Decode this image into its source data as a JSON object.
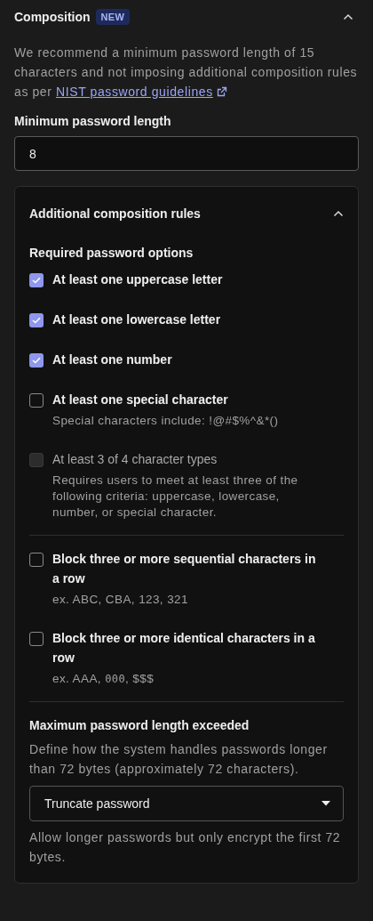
{
  "section": {
    "title": "Composition",
    "badge": "NEW",
    "expanded": true,
    "description": "We recommend a minimum password length of 15 characters and not imposing additional composition rules as per ",
    "link": "NIST password guidelines",
    "min_length": {
      "label": "Minimum password length",
      "value": "8"
    }
  },
  "rules": {
    "title": "Additional composition rules",
    "expanded": true,
    "subtitle": "Required password options",
    "groups": [
      [
        {
          "label": "At least one uppercase letter",
          "checked": true,
          "disabled": false
        },
        {
          "label": "At least one lowercase letter",
          "checked": true,
          "disabled": false
        },
        {
          "label": "At least one number",
          "checked": true,
          "disabled": false
        },
        {
          "label": "At least one special character",
          "checked": false,
          "disabled": false,
          "hint": [
            {
              "kind": "text",
              "text": "Special characters include: !@#$%^&*()"
            }
          ]
        },
        {
          "label": "At least 3 of 4 character types",
          "checked": false,
          "disabled": true,
          "hint": [
            {
              "kind": "text",
              "text": "Requires users to meet at least three of the following criteria: uppercase, lowercase, number, or special character."
            }
          ]
        }
      ],
      [
        {
          "label": "Block three or more sequential characters in a row",
          "checked": false,
          "disabled": false,
          "hint": [
            {
              "kind": "text",
              "text": "ex. ABC, CBA, 123, 321"
            }
          ]
        },
        {
          "label": "Block three or more identical characters in a row",
          "checked": false,
          "disabled": false,
          "hint": [
            {
              "kind": "text",
              "text": "ex. AAA, "
            },
            {
              "kind": "code",
              "text": "000"
            },
            {
              "kind": "text",
              "text": ", $$$"
            }
          ]
        }
      ]
    ],
    "max_length": {
      "title": "Maximum password length exceeded",
      "description": "Define how the system handles passwords longer than 72 bytes (approximately 72 characters).",
      "select": "Truncate password",
      "help": "Allow longer passwords but only encrypt the first 72 bytes."
    }
  }
}
